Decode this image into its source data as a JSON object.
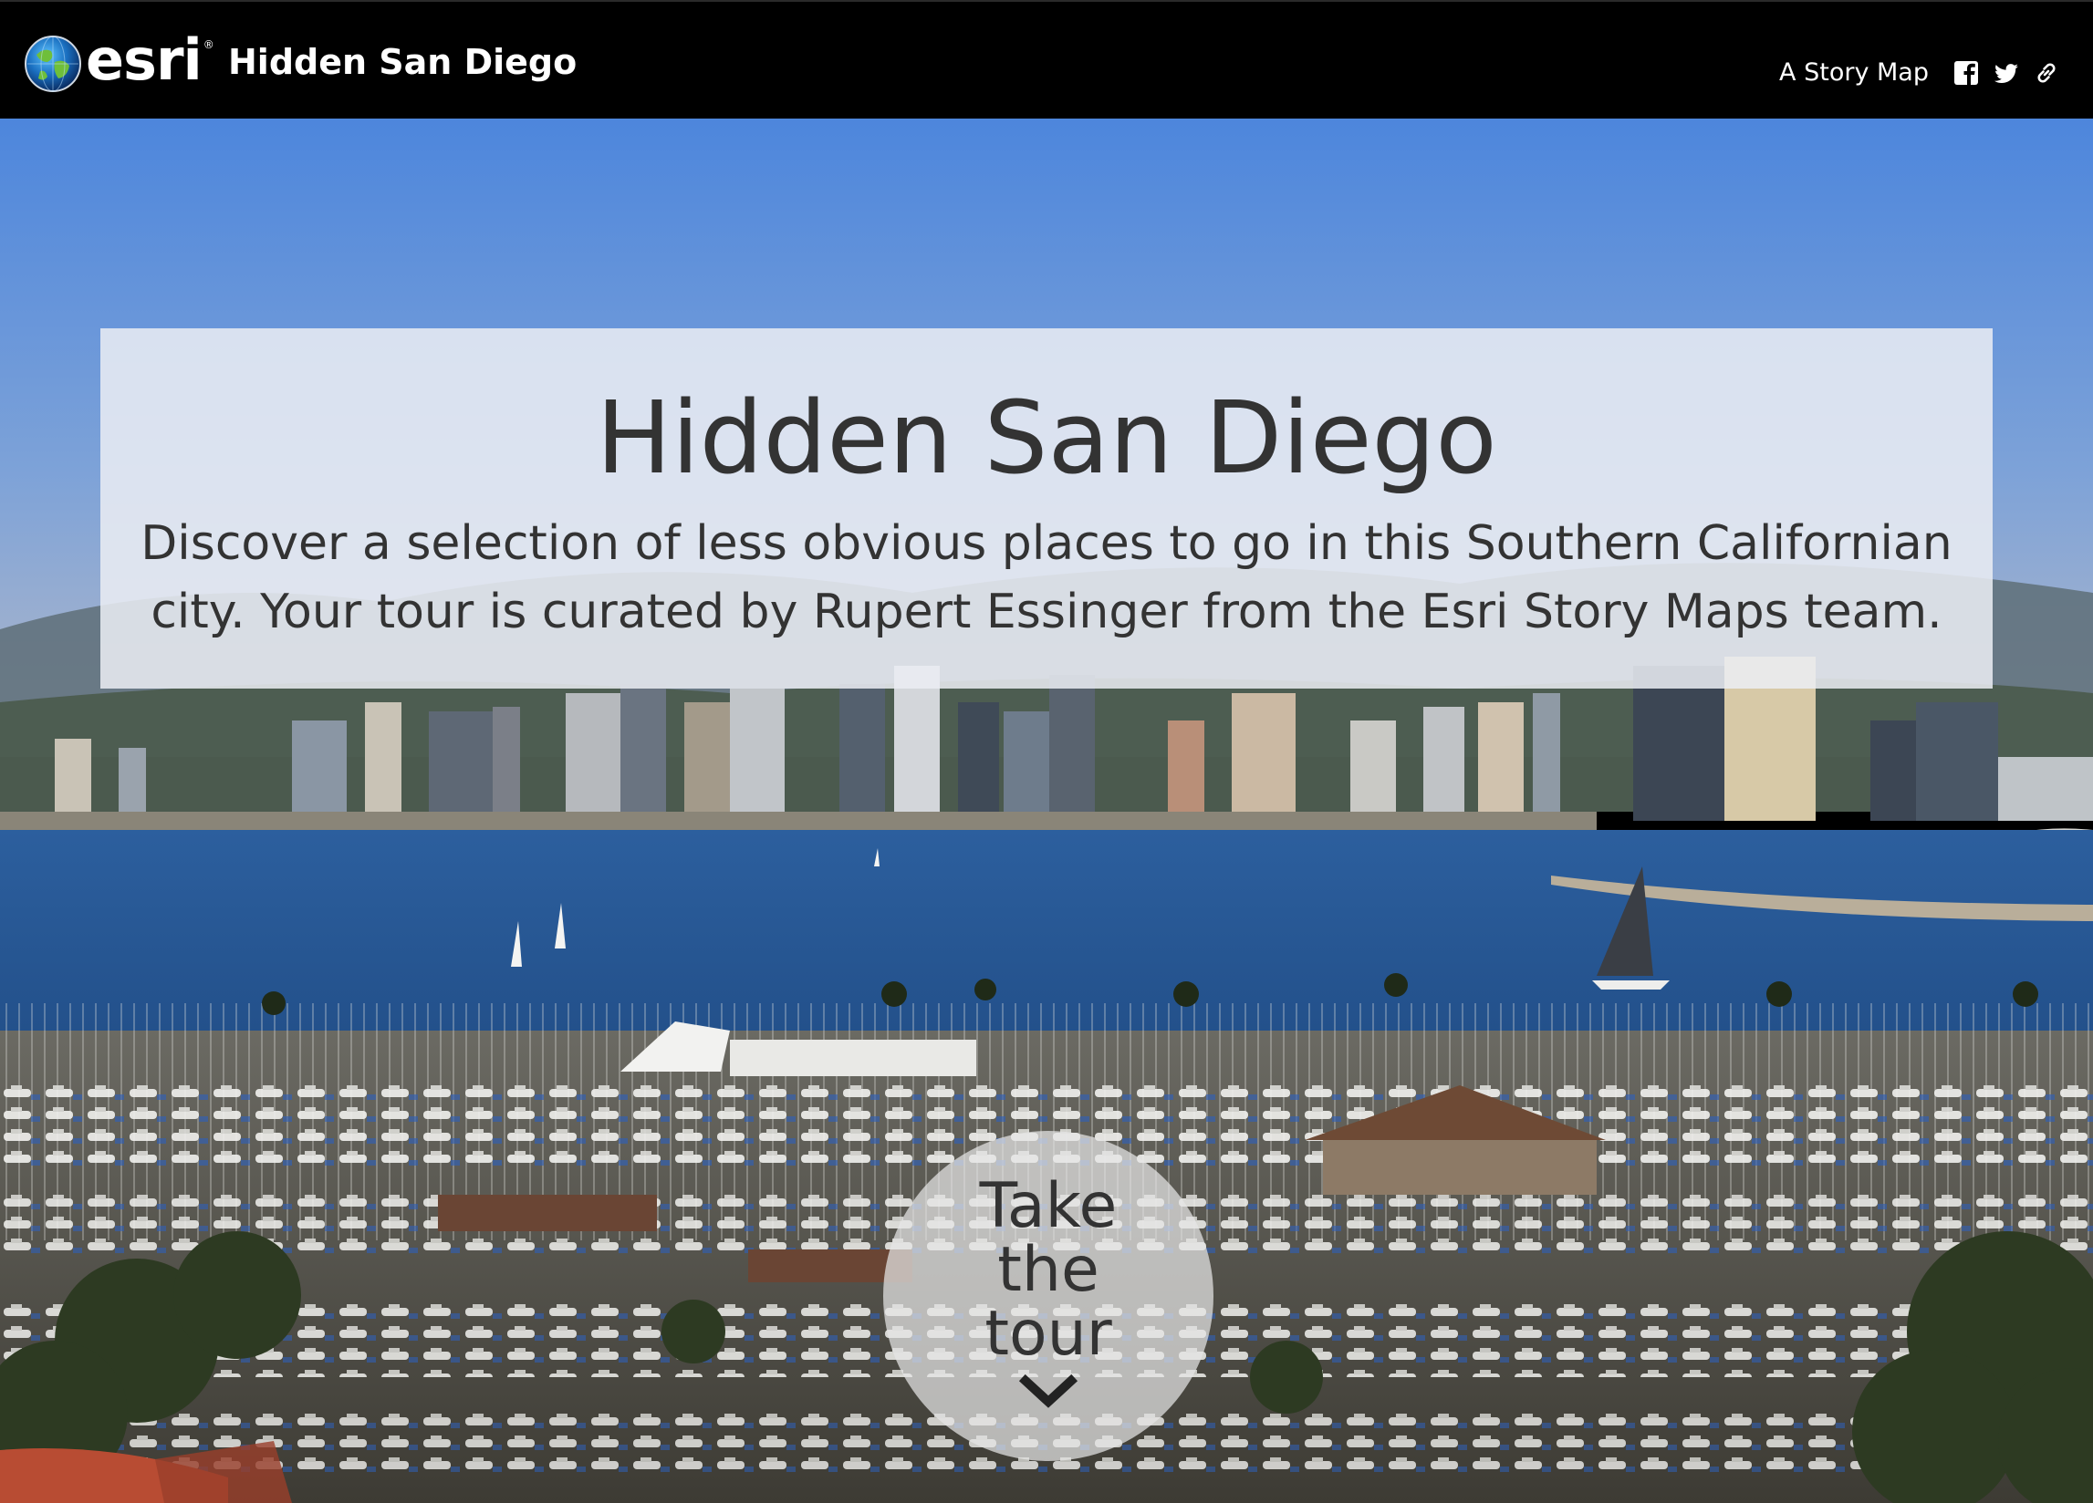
{
  "header": {
    "logo_text": "esri",
    "title": "Hidden San Diego",
    "story_map_label": "A Story Map",
    "social": [
      {
        "icon": "facebook-icon"
      },
      {
        "icon": "twitter-icon"
      },
      {
        "icon": "link-icon"
      }
    ]
  },
  "hero": {
    "title": "Hidden San Diego",
    "subtitle": "Discover a selection of less obvious places to go in this Southern Californian city. Your tour is curated by Rupert Essinger from the Esri Story Maps team.",
    "background": "San Diego skyline and harbor marina photo"
  },
  "tour_button": {
    "label": "Take the tour",
    "icon": "chevron-down-icon"
  },
  "colors": {
    "header_bg": "#000000",
    "sky": "#4f87d6",
    "bay": "#2a5a9a",
    "panel_bg": "#ebeef3",
    "text": "#333333"
  }
}
